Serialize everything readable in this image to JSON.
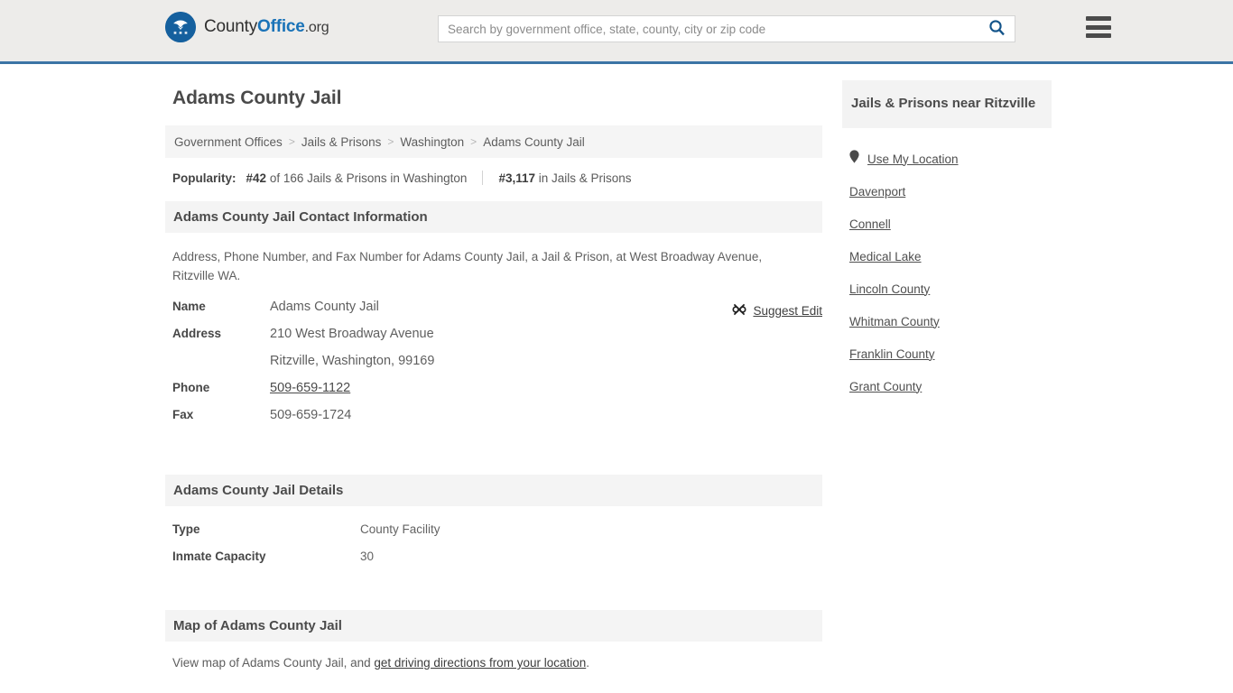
{
  "header": {
    "brand": {
      "part1": "County",
      "part2": "Office",
      "part3": ".org",
      "logo_icon": "eagle-stars-seal-icon"
    },
    "search": {
      "placeholder": "Search by government office, state, county, city or zip code",
      "value": "",
      "icon": "search-icon"
    },
    "menu_icon": "hamburger-menu-icon",
    "accent_color": "#3b74a5",
    "link_blue": "#13548a"
  },
  "main": {
    "page_title": "Adams County Jail",
    "breadcrumb": {
      "items": [
        {
          "label": "Government Offices"
        },
        {
          "label": "Jails & Prisons"
        },
        {
          "label": "Washington"
        },
        {
          "label": "Adams County Jail"
        }
      ],
      "separator": ">"
    },
    "popularity": {
      "label": "Popularity:",
      "rank_state": "#42",
      "rank_state_suffix": "of 166 Jails & Prisons in Washington",
      "rank_national": "#3,117",
      "rank_national_suffix": "in Jails & Prisons"
    },
    "contact_section": {
      "heading": "Adams County Jail Contact Information",
      "description": "Address, Phone Number, and Fax Number for Adams County Jail, a Jail & Prison, at West Broadway Avenue, Ritzville WA.",
      "suggest_edit": {
        "label": "Suggest Edit",
        "icon": "suggest-edit-icon"
      },
      "rows": [
        {
          "key": "Name",
          "value": "Adams County Jail",
          "link": false
        },
        {
          "key": "Address",
          "value": "210 West Broadway Avenue",
          "link": false
        },
        {
          "key": "",
          "value": "Ritzville, Washington, 99169",
          "link": false
        },
        {
          "key": "Phone",
          "value": "509-659-1122",
          "link": true
        },
        {
          "key": "Fax",
          "value": "509-659-1724",
          "link": false
        }
      ]
    },
    "details_section": {
      "heading": "Adams County Jail Details",
      "rows": [
        {
          "key": "Type",
          "value": "County Facility"
        },
        {
          "key": "Inmate Capacity",
          "value": "30"
        }
      ]
    },
    "map_section": {
      "heading": "Map of Adams County Jail",
      "text_before": "View map of Adams County Jail, and ",
      "link_text": "get driving directions from your location",
      "text_after": "."
    }
  },
  "sidebar": {
    "heading": "Jails & Prisons near Ritzville",
    "items": [
      {
        "label": "Use My Location",
        "icon": "map-pin-icon"
      },
      {
        "label": "Davenport",
        "icon": ""
      },
      {
        "label": "Connell",
        "icon": ""
      },
      {
        "label": "Medical Lake",
        "icon": ""
      },
      {
        "label": "Lincoln County",
        "icon": ""
      },
      {
        "label": "Whitman County",
        "icon": ""
      },
      {
        "label": "Franklin County",
        "icon": ""
      },
      {
        "label": "Grant County",
        "icon": ""
      }
    ]
  }
}
